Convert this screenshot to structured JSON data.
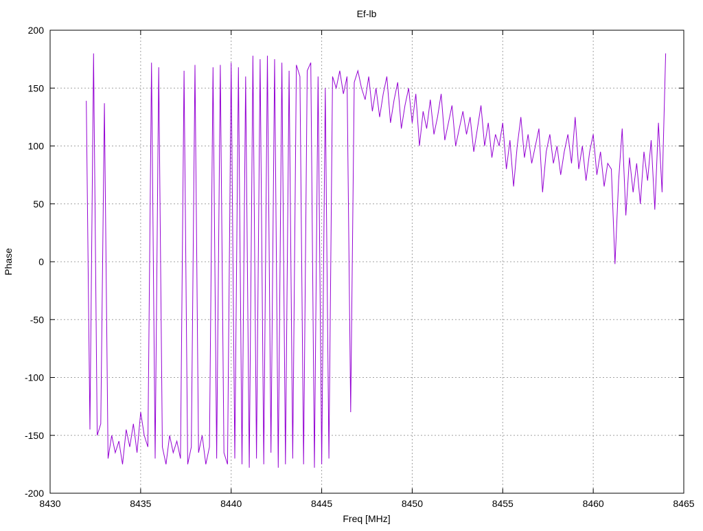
{
  "chart_data": {
    "type": "line",
    "title": "Ef-lb",
    "xlabel": "Freq [MHz]",
    "ylabel": "Phase",
    "xlim": [
      8430,
      8465
    ],
    "ylim": [
      -200,
      200
    ],
    "xticks": [
      "8430",
      "8435",
      "8440",
      "8445",
      "8450",
      "8455",
      "8460",
      "8465"
    ],
    "yticks": [
      "200",
      "150",
      "100",
      "50",
      "0",
      "-50",
      "-100",
      "-150",
      "-200"
    ],
    "grid": true,
    "legend": "none",
    "series_color": "#9400d3",
    "x_start": 8432,
    "x_step": 0.2,
    "values": [
      139,
      -145,
      180,
      -150,
      -140,
      137,
      -170,
      -150,
      -165,
      -155,
      -175,
      -145,
      -160,
      -140,
      -165,
      -130,
      -150,
      -160,
      172,
      -170,
      168,
      -160,
      -175,
      -150,
      -165,
      -155,
      -170,
      165,
      -175,
      -160,
      170,
      -165,
      -150,
      -175,
      -160,
      168,
      -170,
      170,
      -165,
      -175,
      172,
      -170,
      168,
      -175,
      160,
      -178,
      178,
      -170,
      175,
      -175,
      178,
      -165,
      175,
      -178,
      172,
      -175,
      165,
      -170,
      170,
      160,
      -175,
      165,
      172,
      -178,
      160,
      -175,
      150,
      -170,
      160,
      150,
      165,
      145,
      160,
      -130,
      155,
      165,
      150,
      140,
      160,
      130,
      150,
      125,
      145,
      160,
      120,
      140,
      155,
      115,
      135,
      150,
      120,
      145,
      100,
      130,
      115,
      140,
      110,
      125,
      145,
      105,
      120,
      135,
      100,
      115,
      130,
      110,
      125,
      95,
      115,
      135,
      100,
      120,
      90,
      110,
      100,
      120,
      80,
      105,
      65,
      100,
      125,
      90,
      110,
      85,
      100,
      115,
      60,
      95,
      110,
      85,
      100,
      75,
      95,
      110,
      85,
      125,
      80,
      100,
      70,
      95,
      110,
      75,
      95,
      65,
      85,
      80,
      -2,
      70,
      115,
      40,
      90,
      60,
      85,
      50,
      95,
      70,
      105,
      45,
      120,
      60,
      180
    ]
  }
}
